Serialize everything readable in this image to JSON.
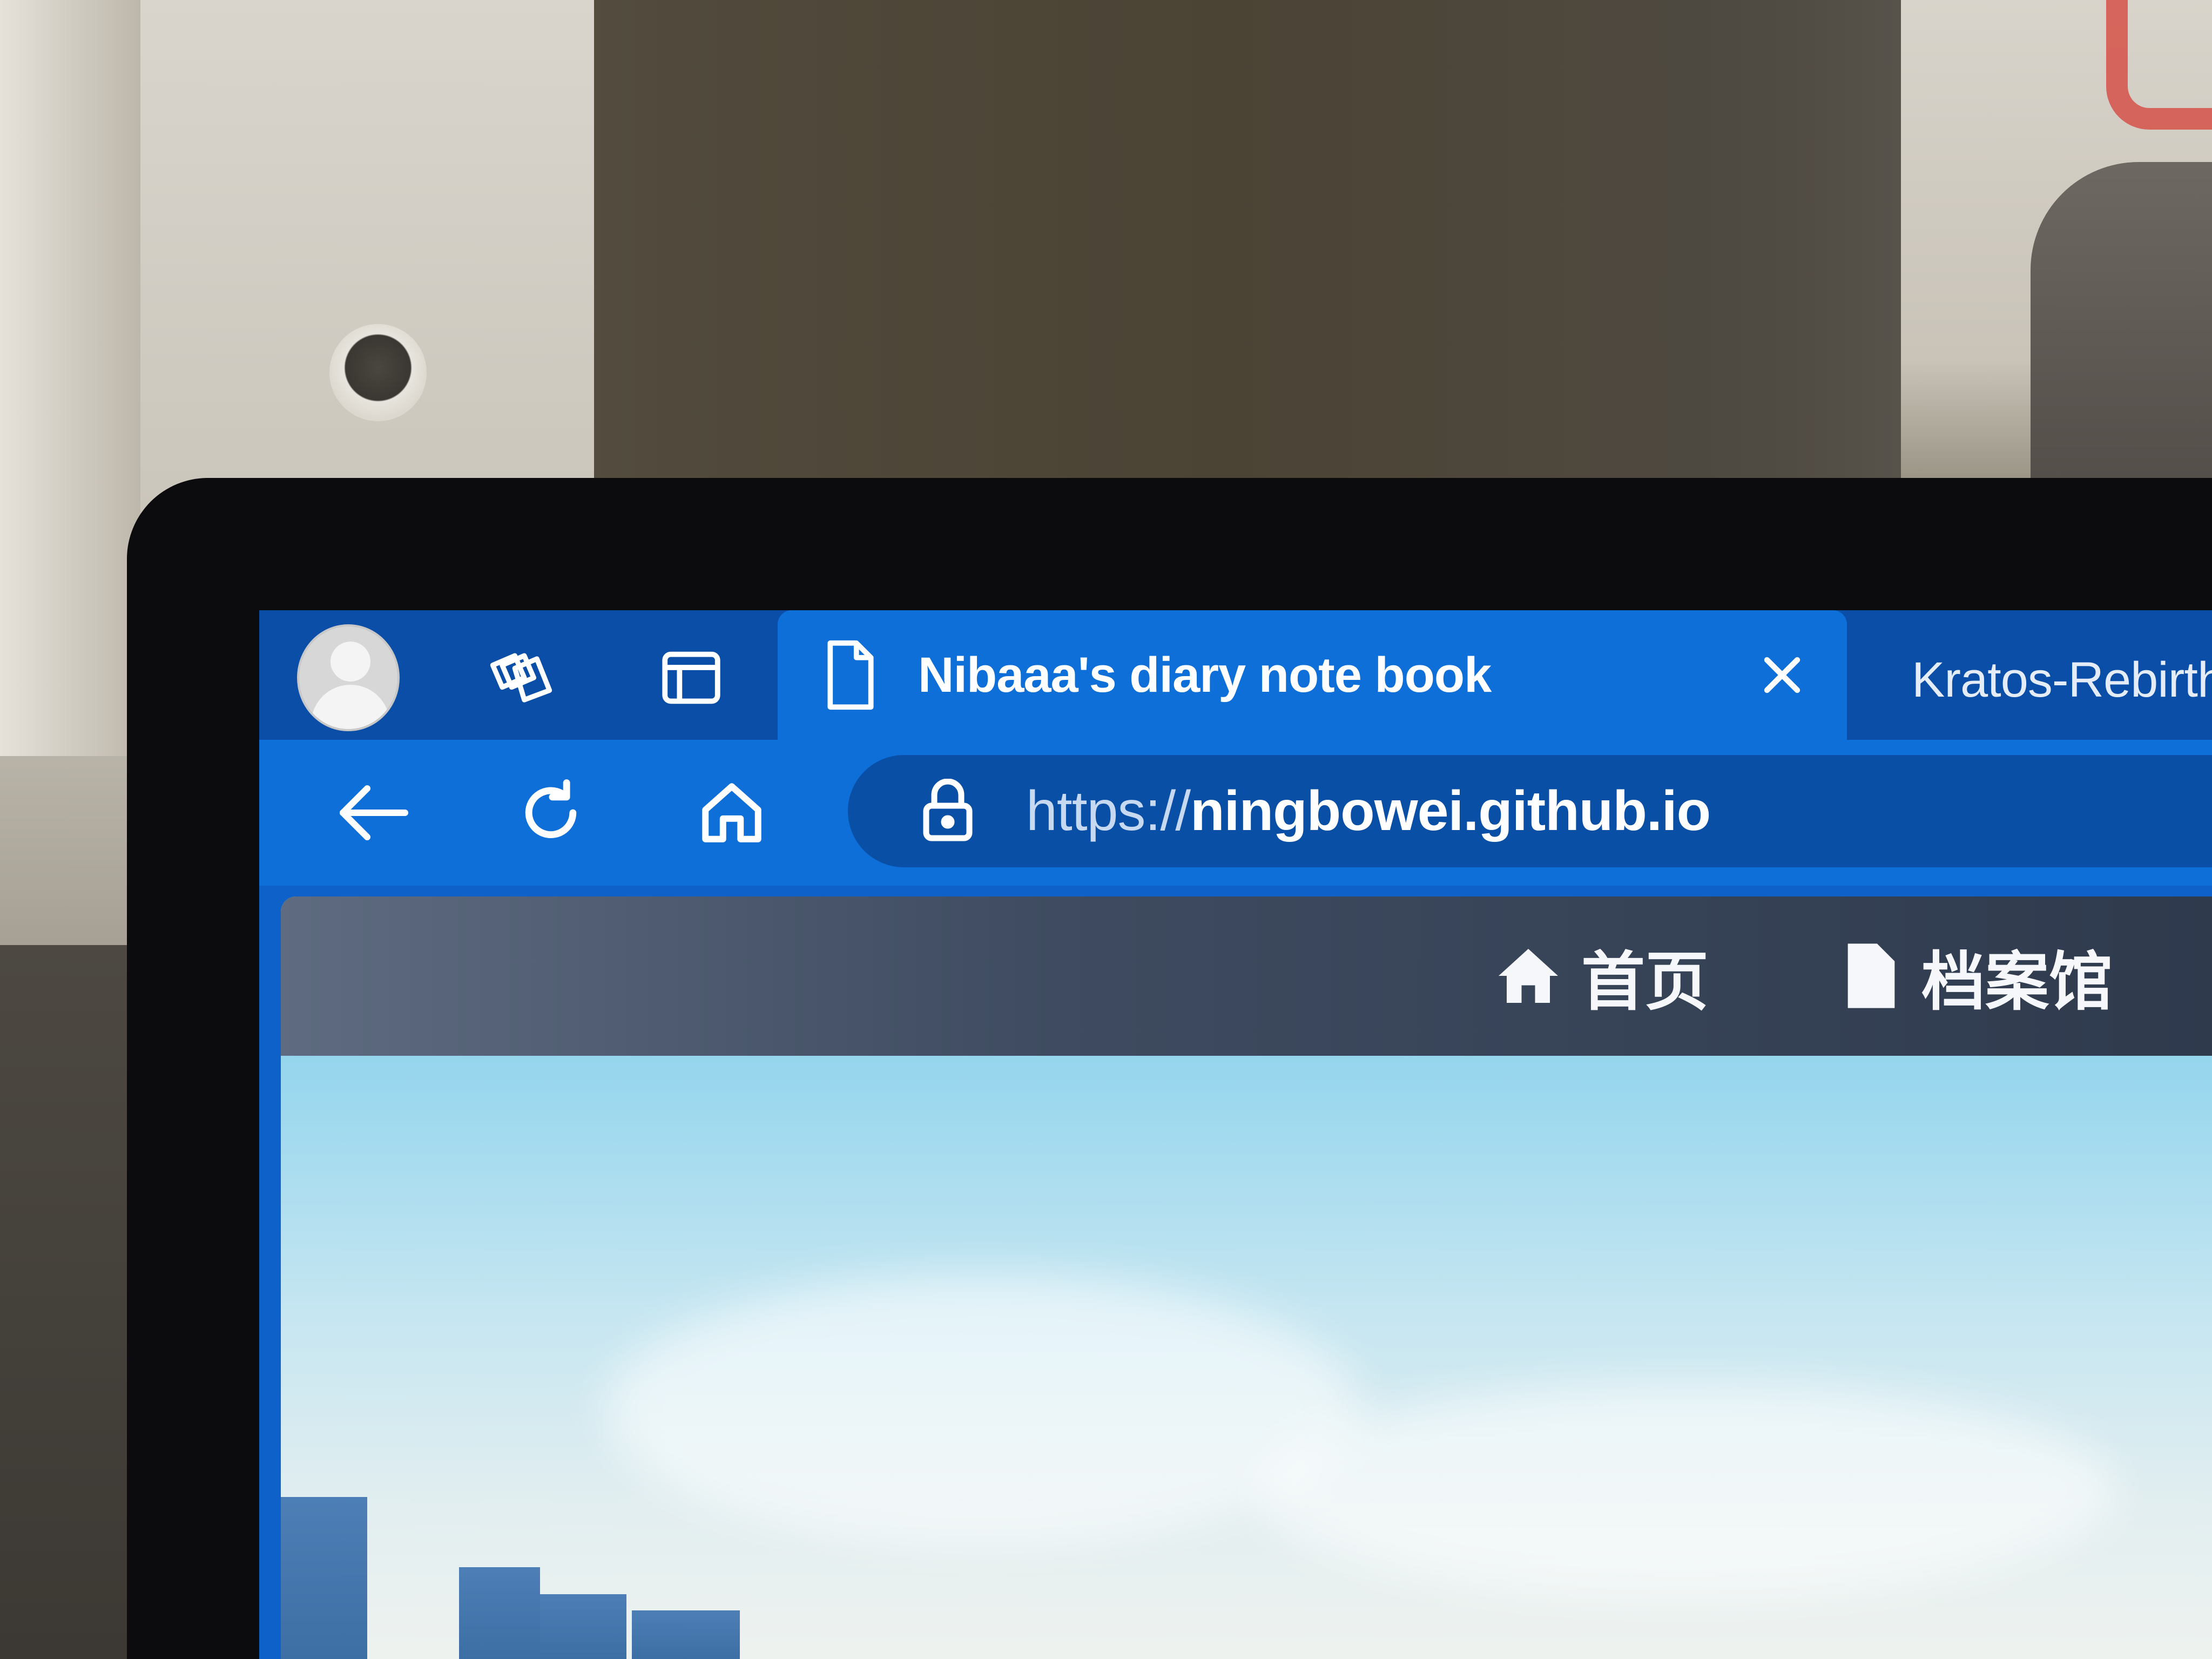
{
  "tabs": [
    {
      "title": "Nibaaa's diary note book",
      "active": true,
      "icon": "page-icon",
      "close_icon": "close-icon"
    },
    {
      "title": "Kratos-Rebirth食用说明",
      "active": false,
      "icon": "site-favicon"
    }
  ],
  "toolbar": {
    "profile_icon": "avatar-icon",
    "collections_icon": "collections-icon",
    "tab_actions_icon": "vertical-tabs-icon"
  },
  "nav": {
    "back_icon": "back-arrow-icon",
    "refresh_icon": "refresh-icon",
    "home_icon": "home-icon"
  },
  "address": {
    "lock_icon": "lock-icon",
    "scheme": "https://",
    "host": "ningbowei.github.io"
  },
  "site_nav": {
    "items": [
      {
        "label": "首页",
        "icon": "home-icon"
      },
      {
        "label": "档案馆",
        "icon": "document-icon"
      }
    ]
  },
  "colors": {
    "tab_strip": "#0b4ea8",
    "active_tab": "#0e6fd8",
    "address_bar": "#0a4fa6",
    "site_header": "#3e4b60"
  }
}
